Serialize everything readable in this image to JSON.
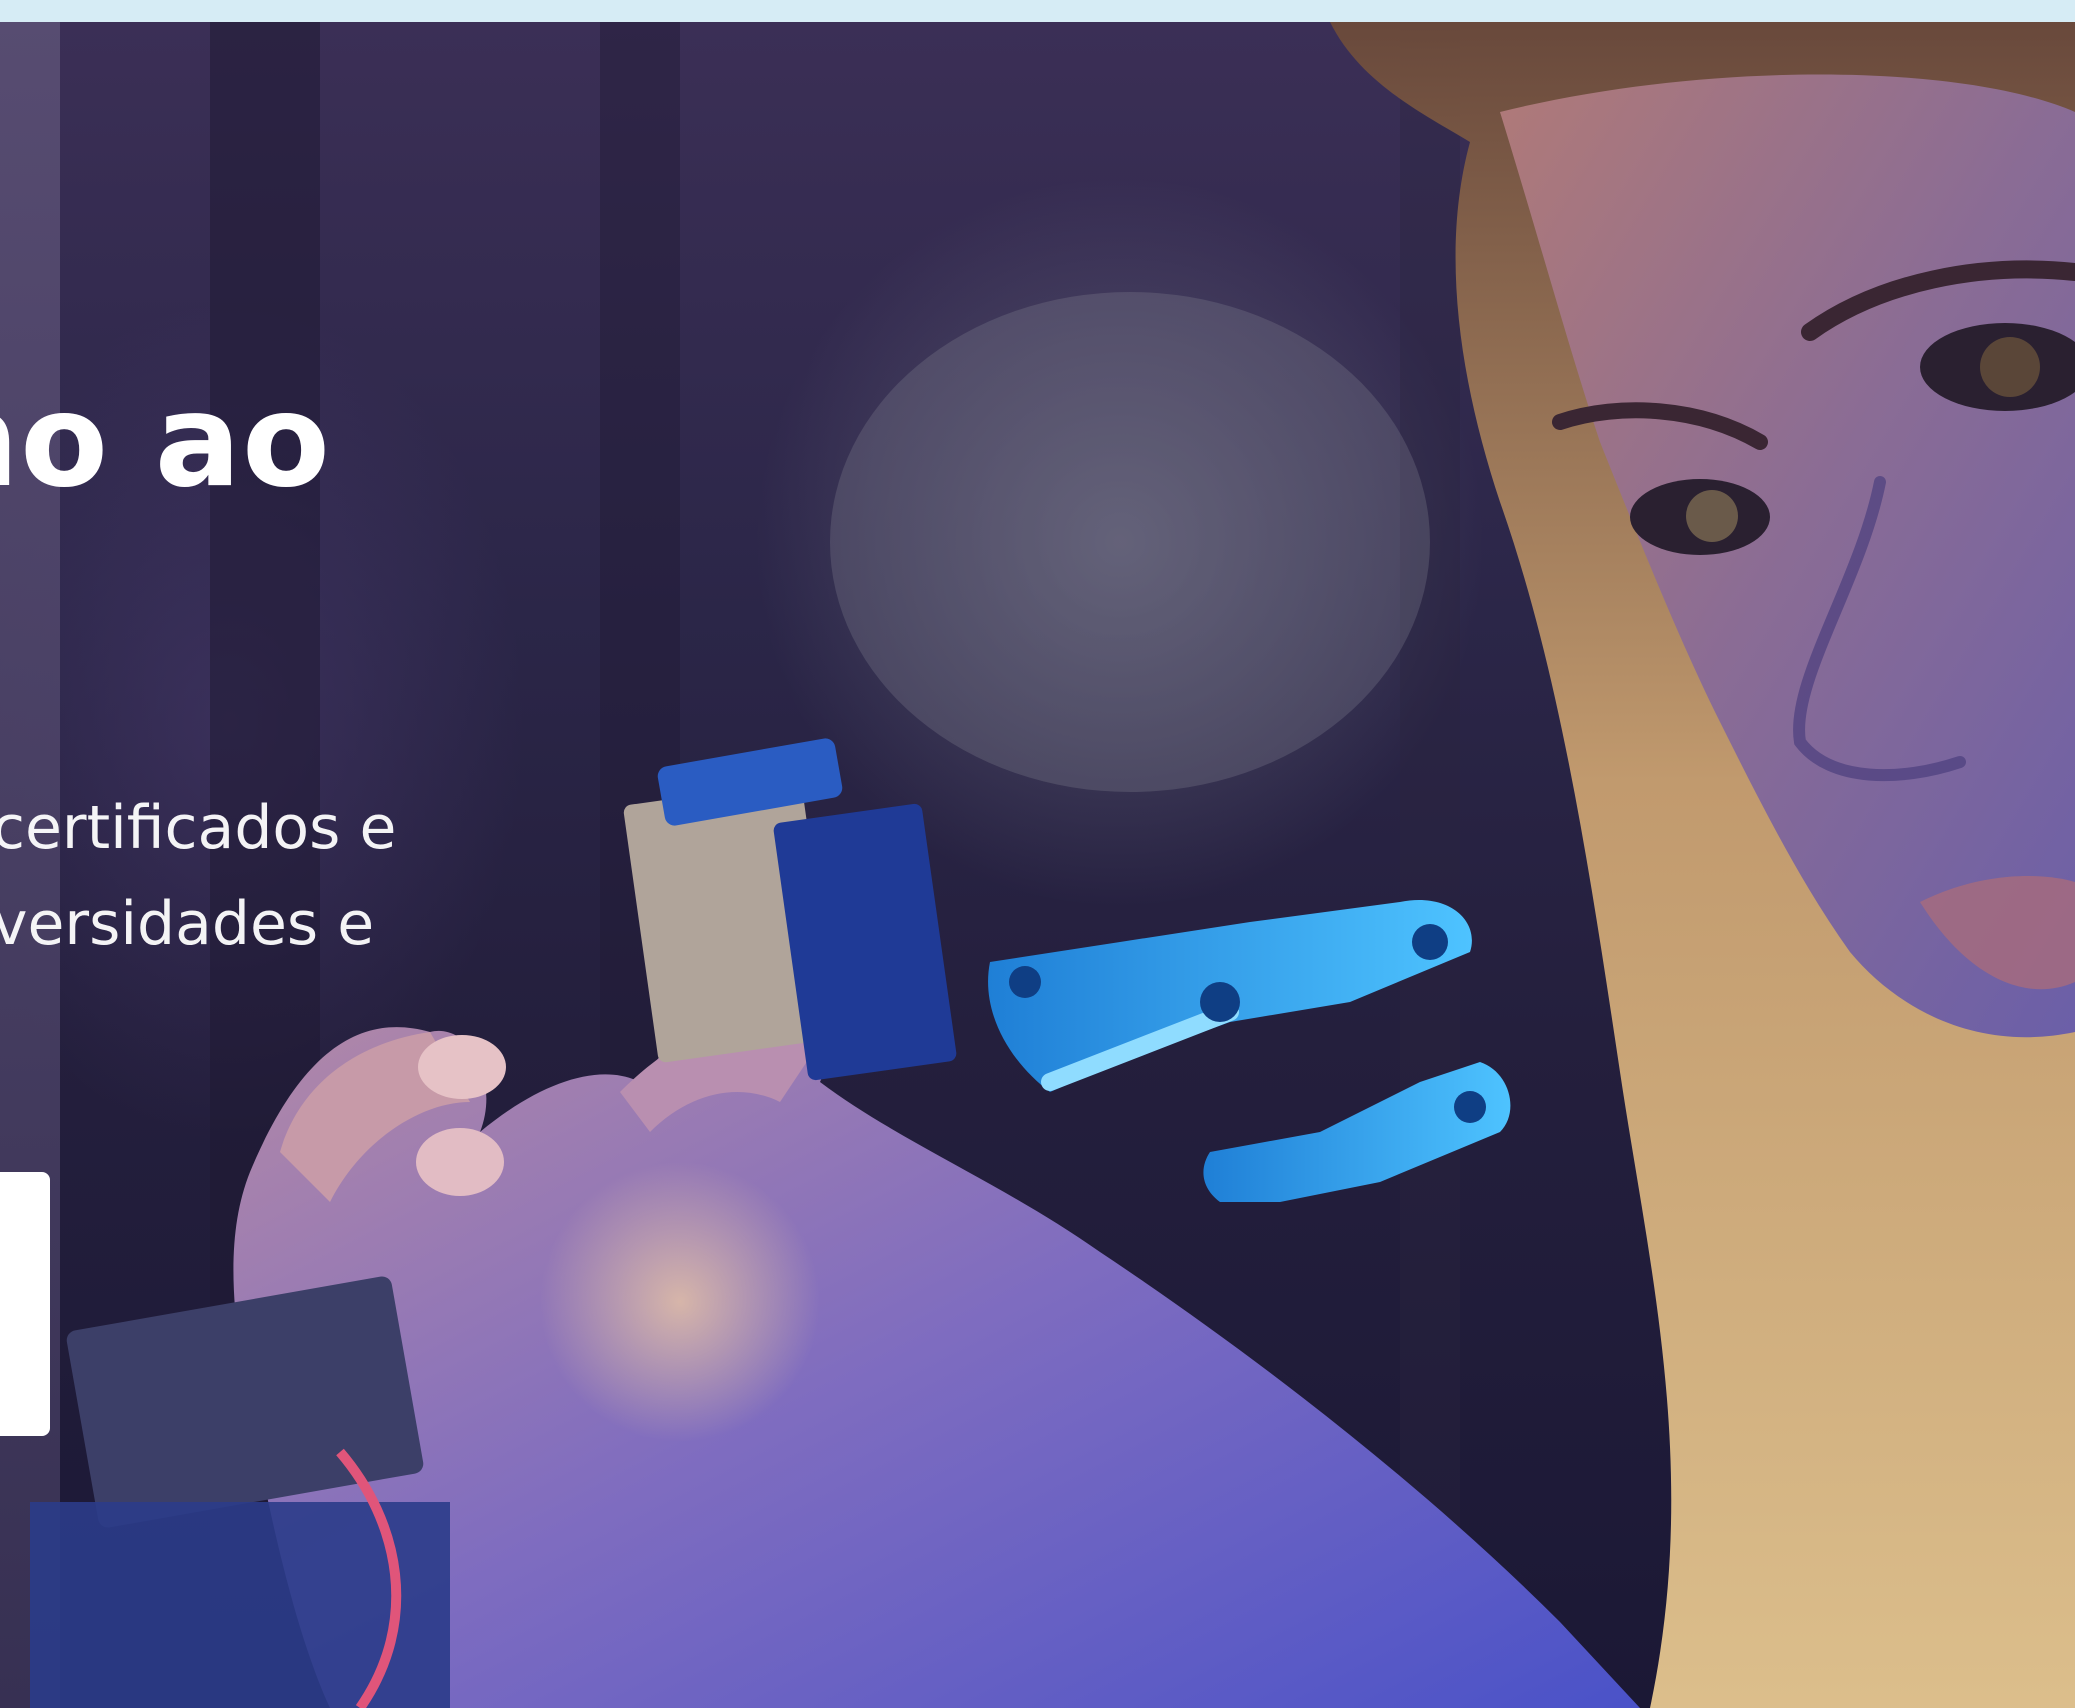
{
  "top_strip": {
    "color": "#d6ecf5"
  },
  "hero": {
    "title": "no ao",
    "subtitle_lines": [
      "certificados e",
      "versidades e"
    ],
    "cta_label": "",
    "image_description_icon": "robotic-hand-photo"
  },
  "colors": {
    "hero_text": "#ffffff",
    "cta_background": "#ffffff",
    "robot_blue": "#2aa7ea"
  }
}
